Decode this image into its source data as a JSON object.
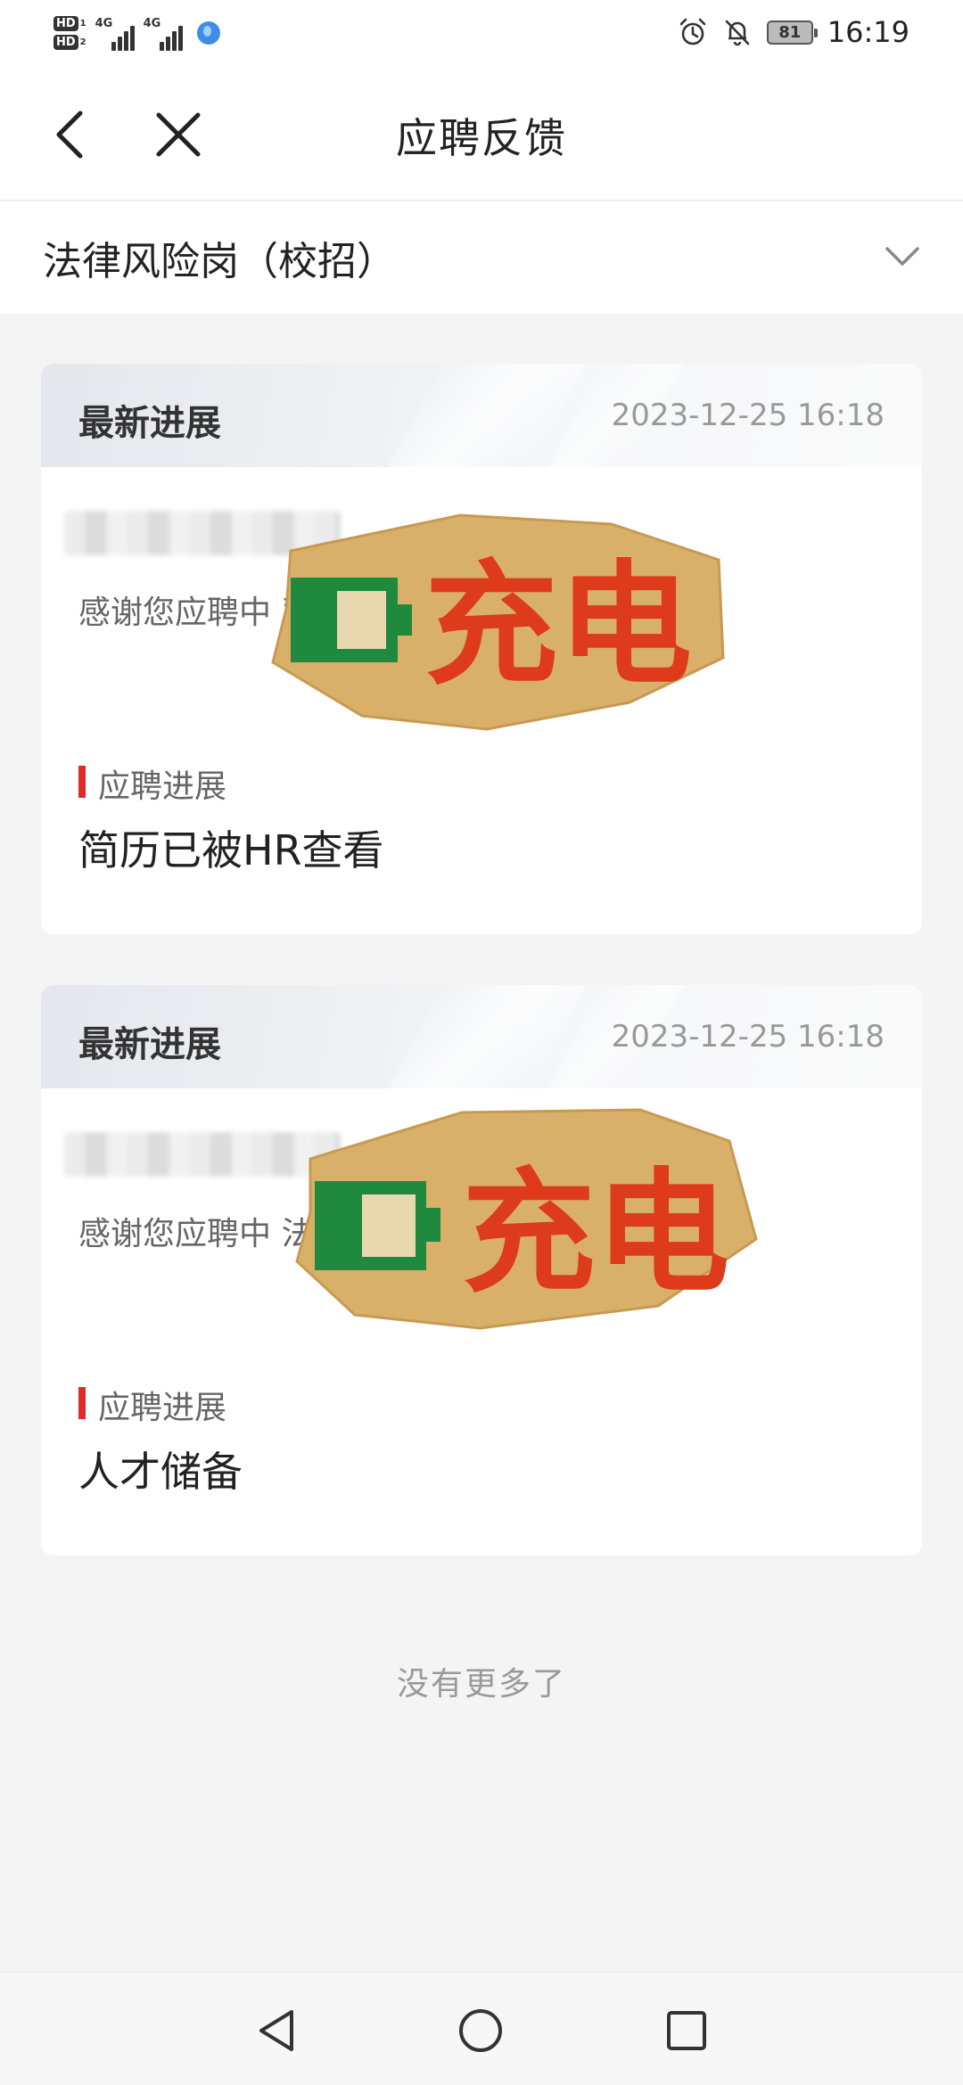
{
  "status_bar": {
    "time": "16:19",
    "battery": "81",
    "hd1": "HD",
    "hd1_sub": "1",
    "hd2": "HD",
    "hd2_sub": "2",
    "net1": "4G",
    "net2": "4G",
    "icons": [
      "alarm-icon",
      "mute-icon"
    ]
  },
  "nav": {
    "title": "应聘反馈",
    "back_icon": "chevron-left-icon",
    "close_icon": "close-icon"
  },
  "job_selector": {
    "value": "法律风险岗（校招）",
    "icon": "chevron-down-icon"
  },
  "cards": [
    {
      "header_label": "最新进展",
      "timestamp": "2023-12-25 16:18",
      "body_text": "感谢您应聘中                                      司的 法律风险岗（校",
      "progress_label": "应聘进展",
      "progress_value": "简历已被HR查看",
      "sticker_text": "充电"
    },
    {
      "header_label": "最新进展",
      "timestamp": "2023-12-25 16:18",
      "body_text": "感谢您应聘中                                        法律风险岗（校招",
      "progress_label": "应聘进展",
      "progress_value": "人才储备",
      "sticker_text": "充电"
    }
  ],
  "footer_text": "没有更多了",
  "colors": {
    "accent_red": "#e12a2a",
    "sticker_bg": "#d9b06a",
    "sticker_text": "#dd3b1c",
    "battery_green": "#1f8a3e"
  },
  "bottom_nav": {
    "icons": [
      "back-triangle-icon",
      "home-circle-icon",
      "recents-square-icon"
    ]
  }
}
